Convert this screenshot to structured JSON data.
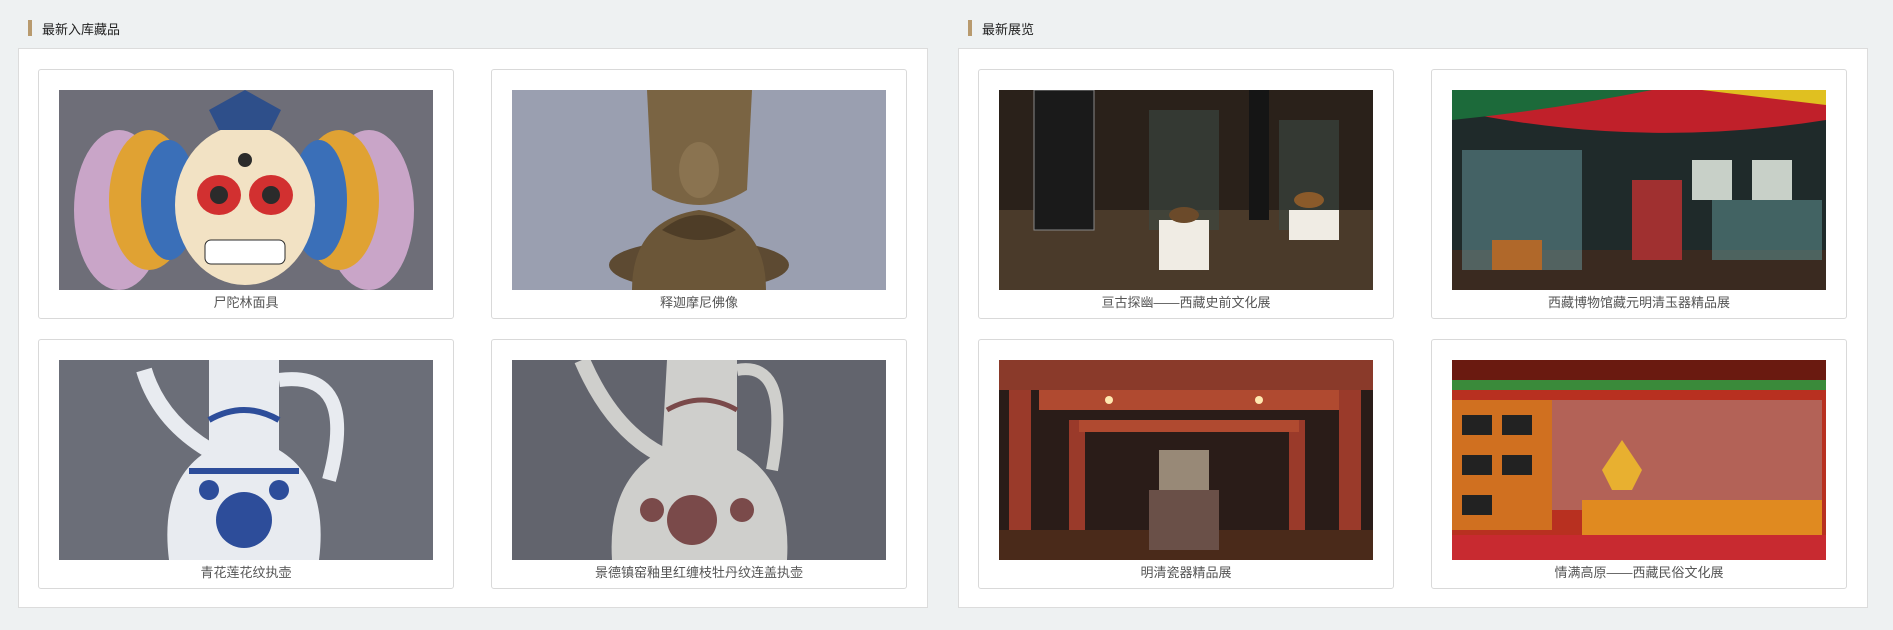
{
  "collections": {
    "title": "最新入库藏品",
    "items": [
      {
        "caption": "尸陀林面具",
        "image": "tibetan-mask"
      },
      {
        "caption": "释迦摩尼佛像",
        "image": "bronze-buddha"
      },
      {
        "caption": "青花莲花纹执壶",
        "image": "blue-white-ewer"
      },
      {
        "caption": "景德镇窑釉里红缠枝牡丹纹连盖执壶",
        "image": "red-underglaze-ewer"
      }
    ]
  },
  "exhibitions": {
    "title": "最新展览",
    "items": [
      {
        "caption": "亘古探幽——西藏史前文化展",
        "image": "prehistoric-hall"
      },
      {
        "caption": "西藏博物馆藏元明清玉器精品展",
        "image": "jade-hall"
      },
      {
        "caption": "明清瓷器精品展",
        "image": "porcelain-hall"
      },
      {
        "caption": "情满高原——西藏民俗文化展",
        "image": "folk-hall"
      }
    ]
  },
  "colors": {
    "accent_bar": "#b89a6e",
    "page_bg": "#eef1f2"
  }
}
